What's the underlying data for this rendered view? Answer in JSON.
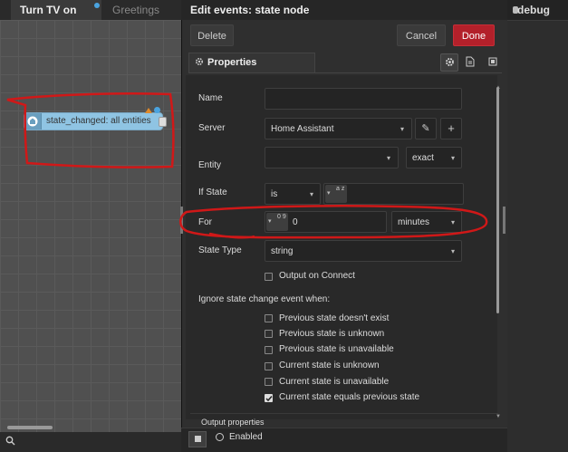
{
  "canvas": {
    "tabs": [
      {
        "label": "Turn TV on"
      },
      {
        "label": "Greetings"
      }
    ],
    "node_label": "state_changed: all entities"
  },
  "sidebar_right": {
    "title": "debug"
  },
  "tray": {
    "title": "Edit events: state node",
    "delete_label": "Delete",
    "cancel_label": "Cancel",
    "done_label": "Done",
    "properties_label": "Properties"
  },
  "form": {
    "name": {
      "label": "Name",
      "value": ""
    },
    "server": {
      "label": "Server",
      "value": "Home Assistant"
    },
    "entity": {
      "label": "Entity",
      "value": "",
      "match": "exact"
    },
    "if_state": {
      "label": "If State",
      "operator": "is",
      "type_hint": "a z",
      "value": ""
    },
    "for": {
      "label": "For",
      "type_hint": "0 9",
      "value": "0",
      "unit": "minutes"
    },
    "state_type": {
      "label": "State Type",
      "value": "string"
    },
    "output_on_connect": {
      "label": "Output on Connect",
      "checked": false
    },
    "ignore_heading": "Ignore state change event when:",
    "ignore_options": [
      {
        "label": "Previous state doesn't exist",
        "checked": false
      },
      {
        "label": "Previous state is unknown",
        "checked": false
      },
      {
        "label": "Previous state is unavailable",
        "checked": false
      },
      {
        "label": "Current state is unknown",
        "checked": false
      },
      {
        "label": "Current state is unavailable",
        "checked": false
      },
      {
        "label": "Current state equals previous state",
        "checked": true
      }
    ],
    "output_properties_label": "Output properties"
  },
  "footer": {
    "enabled_label": "Enabled"
  },
  "colors": {
    "done": "#b3202a",
    "node": "#8fc4e3",
    "annotation": "#d01818"
  },
  "icons": {
    "properties": "gear-icon",
    "description": "document-icon",
    "appearance": "frame-icon",
    "search": "search-icon",
    "edit": "pencil-icon",
    "add": "plus-icon"
  }
}
